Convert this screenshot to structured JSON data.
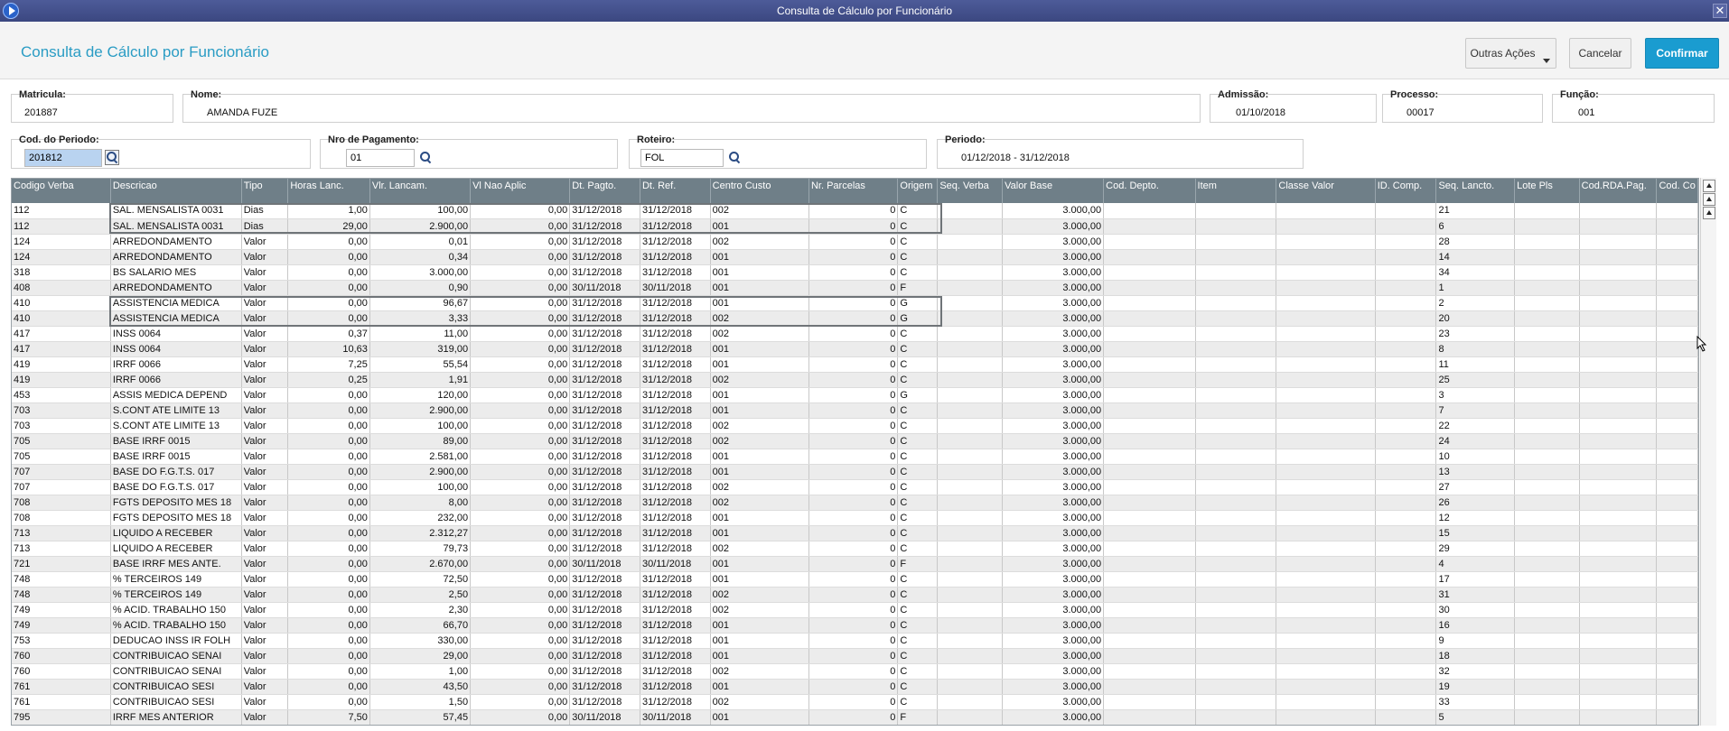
{
  "window": {
    "title": "Consulta de Cálculo por Funcionário"
  },
  "header": {
    "title": "Consulta de Cálculo por Funcionário",
    "buttons": {
      "outras_acoes": "Outras Ações",
      "cancelar": "Cancelar",
      "confirmar": "Confirmar"
    }
  },
  "form": {
    "matricula": {
      "label": "Matricula:",
      "value": "201887"
    },
    "nome": {
      "label": "Nome:",
      "value": "AMANDA FUZE"
    },
    "admissao": {
      "label": "Admissão:",
      "value": "01/10/2018"
    },
    "processo": {
      "label": "Processo:",
      "value": "00017"
    },
    "funcao": {
      "label": "Função:",
      "value": "001"
    },
    "periodo_cod": {
      "label": "Cod. do Periodo:",
      "value": "201812"
    },
    "nro_pagamento": {
      "label": "Nro de Pagamento:",
      "value": "01"
    },
    "roteiro": {
      "label": "Roteiro:",
      "value": "FOL"
    },
    "periodo": {
      "label": "Periodo:",
      "value": "01/12/2018 - 31/12/2018"
    }
  },
  "grid": {
    "columns": [
      "Codigo Verba",
      "Descricao",
      "Tipo",
      "Horas Lanc.",
      "Vlr. Lancam.",
      "Vl Nao Aplic",
      "Dt. Pagto.",
      "Dt. Ref.",
      "Centro Custo",
      "Nr. Parcelas",
      "Origem",
      "Seq. Verba",
      "Valor Base",
      "Cod. Depto.",
      "Item",
      "Classe Valor",
      "ID. Comp.",
      "Seq. Lancto.",
      "Lote Pls",
      "Cod.RDA.Pag.",
      "Cod. Co"
    ],
    "rows": [
      [
        "112",
        "SAL. MENSALISTA 0031",
        "Dias",
        "1,00",
        "100,00",
        "0,00",
        "31/12/2018",
        "31/12/2018",
        "002",
        "0",
        "C",
        "",
        "3.000,00",
        "",
        "",
        "",
        "",
        "21",
        "",
        "",
        ""
      ],
      [
        "112",
        "SAL. MENSALISTA 0031",
        "Dias",
        "29,00",
        "2.900,00",
        "0,00",
        "31/12/2018",
        "31/12/2018",
        "001",
        "0",
        "C",
        "",
        "3.000,00",
        "",
        "",
        "",
        "",
        "6",
        "",
        "",
        ""
      ],
      [
        "124",
        "ARREDONDAMENTO",
        "Valor",
        "0,00",
        "0,01",
        "0,00",
        "31/12/2018",
        "31/12/2018",
        "002",
        "0",
        "C",
        "",
        "3.000,00",
        "",
        "",
        "",
        "",
        "28",
        "",
        "",
        ""
      ],
      [
        "124",
        "ARREDONDAMENTO",
        "Valor",
        "0,00",
        "0,34",
        "0,00",
        "31/12/2018",
        "31/12/2018",
        "001",
        "0",
        "C",
        "",
        "3.000,00",
        "",
        "",
        "",
        "",
        "14",
        "",
        "",
        ""
      ],
      [
        "318",
        "BS SALARIO MES",
        "Valor",
        "0,00",
        "3.000,00",
        "0,00",
        "31/12/2018",
        "31/12/2018",
        "001",
        "0",
        "C",
        "",
        "3.000,00",
        "",
        "",
        "",
        "",
        "34",
        "",
        "",
        ""
      ],
      [
        "408",
        "ARREDONDAMENTO",
        "Valor",
        "0,00",
        "0,90",
        "0,00",
        "30/11/2018",
        "30/11/2018",
        "001",
        "0",
        "F",
        "",
        "3.000,00",
        "",
        "",
        "",
        "",
        "1",
        "",
        "",
        ""
      ],
      [
        "410",
        "ASSISTENCIA MEDICA",
        "Valor",
        "0,00",
        "96,67",
        "0,00",
        "31/12/2018",
        "31/12/2018",
        "001",
        "0",
        "G",
        "",
        "3.000,00",
        "",
        "",
        "",
        "",
        "2",
        "",
        "",
        ""
      ],
      [
        "410",
        "ASSISTENCIA MEDICA",
        "Valor",
        "0,00",
        "3,33",
        "0,00",
        "31/12/2018",
        "31/12/2018",
        "002",
        "0",
        "G",
        "",
        "3.000,00",
        "",
        "",
        "",
        "",
        "20",
        "",
        "",
        ""
      ],
      [
        "417",
        "INSS 0064",
        "Valor",
        "0,37",
        "11,00",
        "0,00",
        "31/12/2018",
        "31/12/2018",
        "002",
        "0",
        "C",
        "",
        "3.000,00",
        "",
        "",
        "",
        "",
        "23",
        "",
        "",
        ""
      ],
      [
        "417",
        "INSS 0064",
        "Valor",
        "10,63",
        "319,00",
        "0,00",
        "31/12/2018",
        "31/12/2018",
        "001",
        "0",
        "C",
        "",
        "3.000,00",
        "",
        "",
        "",
        "",
        "8",
        "",
        "",
        ""
      ],
      [
        "419",
        "IRRF 0066",
        "Valor",
        "7,25",
        "55,54",
        "0,00",
        "31/12/2018",
        "31/12/2018",
        "001",
        "0",
        "C",
        "",
        "3.000,00",
        "",
        "",
        "",
        "",
        "11",
        "",
        "",
        ""
      ],
      [
        "419",
        "IRRF 0066",
        "Valor",
        "0,25",
        "1,91",
        "0,00",
        "31/12/2018",
        "31/12/2018",
        "002",
        "0",
        "C",
        "",
        "3.000,00",
        "",
        "",
        "",
        "",
        "25",
        "",
        "",
        ""
      ],
      [
        "453",
        "ASSIS MEDICA DEPEND",
        "Valor",
        "0,00",
        "120,00",
        "0,00",
        "31/12/2018",
        "31/12/2018",
        "001",
        "0",
        "G",
        "",
        "3.000,00",
        "",
        "",
        "",
        "",
        "3",
        "",
        "",
        ""
      ],
      [
        "703",
        "S.CONT ATE LIMITE 13",
        "Valor",
        "0,00",
        "2.900,00",
        "0,00",
        "31/12/2018",
        "31/12/2018",
        "001",
        "0",
        "C",
        "",
        "3.000,00",
        "",
        "",
        "",
        "",
        "7",
        "",
        "",
        ""
      ],
      [
        "703",
        "S.CONT ATE LIMITE 13",
        "Valor",
        "0,00",
        "100,00",
        "0,00",
        "31/12/2018",
        "31/12/2018",
        "002",
        "0",
        "C",
        "",
        "3.000,00",
        "",
        "",
        "",
        "",
        "22",
        "",
        "",
        ""
      ],
      [
        "705",
        "BASE IRRF 0015",
        "Valor",
        "0,00",
        "89,00",
        "0,00",
        "31/12/2018",
        "31/12/2018",
        "002",
        "0",
        "C",
        "",
        "3.000,00",
        "",
        "",
        "",
        "",
        "24",
        "",
        "",
        ""
      ],
      [
        "705",
        "BASE IRRF 0015",
        "Valor",
        "0,00",
        "2.581,00",
        "0,00",
        "31/12/2018",
        "31/12/2018",
        "001",
        "0",
        "C",
        "",
        "3.000,00",
        "",
        "",
        "",
        "",
        "10",
        "",
        "",
        ""
      ],
      [
        "707",
        "BASE DO F.G.T.S. 017",
        "Valor",
        "0,00",
        "2.900,00",
        "0,00",
        "31/12/2018",
        "31/12/2018",
        "001",
        "0",
        "C",
        "",
        "3.000,00",
        "",
        "",
        "",
        "",
        "13",
        "",
        "",
        ""
      ],
      [
        "707",
        "BASE DO F.G.T.S. 017",
        "Valor",
        "0,00",
        "100,00",
        "0,00",
        "31/12/2018",
        "31/12/2018",
        "002",
        "0",
        "C",
        "",
        "3.000,00",
        "",
        "",
        "",
        "",
        "27",
        "",
        "",
        ""
      ],
      [
        "708",
        "FGTS DEPOSITO MES 18",
        "Valor",
        "0,00",
        "8,00",
        "0,00",
        "31/12/2018",
        "31/12/2018",
        "002",
        "0",
        "C",
        "",
        "3.000,00",
        "",
        "",
        "",
        "",
        "26",
        "",
        "",
        ""
      ],
      [
        "708",
        "FGTS DEPOSITO MES 18",
        "Valor",
        "0,00",
        "232,00",
        "0,00",
        "31/12/2018",
        "31/12/2018",
        "001",
        "0",
        "C",
        "",
        "3.000,00",
        "",
        "",
        "",
        "",
        "12",
        "",
        "",
        ""
      ],
      [
        "713",
        "LIQUIDO A RECEBER",
        "Valor",
        "0,00",
        "2.312,27",
        "0,00",
        "31/12/2018",
        "31/12/2018",
        "001",
        "0",
        "C",
        "",
        "3.000,00",
        "",
        "",
        "",
        "",
        "15",
        "",
        "",
        ""
      ],
      [
        "713",
        "LIQUIDO A RECEBER",
        "Valor",
        "0,00",
        "79,73",
        "0,00",
        "31/12/2018",
        "31/12/2018",
        "002",
        "0",
        "C",
        "",
        "3.000,00",
        "",
        "",
        "",
        "",
        "29",
        "",
        "",
        ""
      ],
      [
        "721",
        "BASE IRRF MES ANTE.",
        "Valor",
        "0,00",
        "2.670,00",
        "0,00",
        "30/11/2018",
        "30/11/2018",
        "001",
        "0",
        "F",
        "",
        "3.000,00",
        "",
        "",
        "",
        "",
        "4",
        "",
        "",
        ""
      ],
      [
        "748",
        "% TERCEIROS 149",
        "Valor",
        "0,00",
        "72,50",
        "0,00",
        "31/12/2018",
        "31/12/2018",
        "001",
        "0",
        "C",
        "",
        "3.000,00",
        "",
        "",
        "",
        "",
        "17",
        "",
        "",
        ""
      ],
      [
        "748",
        "% TERCEIROS 149",
        "Valor",
        "0,00",
        "2,50",
        "0,00",
        "31/12/2018",
        "31/12/2018",
        "002",
        "0",
        "C",
        "",
        "3.000,00",
        "",
        "",
        "",
        "",
        "31",
        "",
        "",
        ""
      ],
      [
        "749",
        "% ACID. TRABALHO 150",
        "Valor",
        "0,00",
        "2,30",
        "0,00",
        "31/12/2018",
        "31/12/2018",
        "002",
        "0",
        "C",
        "",
        "3.000,00",
        "",
        "",
        "",
        "",
        "30",
        "",
        "",
        ""
      ],
      [
        "749",
        "% ACID. TRABALHO 150",
        "Valor",
        "0,00",
        "66,70",
        "0,00",
        "31/12/2018",
        "31/12/2018",
        "001",
        "0",
        "C",
        "",
        "3.000,00",
        "",
        "",
        "",
        "",
        "16",
        "",
        "",
        ""
      ],
      [
        "753",
        "DEDUCAO INSS IR FOLH",
        "Valor",
        "0,00",
        "330,00",
        "0,00",
        "31/12/2018",
        "31/12/2018",
        "001",
        "0",
        "C",
        "",
        "3.000,00",
        "",
        "",
        "",
        "",
        "9",
        "",
        "",
        ""
      ],
      [
        "760",
        "CONTRIBUICAO SENAI",
        "Valor",
        "0,00",
        "29,00",
        "0,00",
        "31/12/2018",
        "31/12/2018",
        "001",
        "0",
        "C",
        "",
        "3.000,00",
        "",
        "",
        "",
        "",
        "18",
        "",
        "",
        ""
      ],
      [
        "760",
        "CONTRIBUICAO SENAI",
        "Valor",
        "0,00",
        "1,00",
        "0,00",
        "31/12/2018",
        "31/12/2018",
        "002",
        "0",
        "C",
        "",
        "3.000,00",
        "",
        "",
        "",
        "",
        "32",
        "",
        "",
        ""
      ],
      [
        "761",
        "CONTRIBUICAO SESI",
        "Valor",
        "0,00",
        "43,50",
        "0,00",
        "31/12/2018",
        "31/12/2018",
        "001",
        "0",
        "C",
        "",
        "3.000,00",
        "",
        "",
        "",
        "",
        "19",
        "",
        "",
        ""
      ],
      [
        "761",
        "CONTRIBUICAO SESI",
        "Valor",
        "0,00",
        "1,50",
        "0,00",
        "31/12/2018",
        "31/12/2018",
        "002",
        "0",
        "C",
        "",
        "3.000,00",
        "",
        "",
        "",
        "",
        "33",
        "",
        "",
        ""
      ],
      [
        "795",
        "IRRF MES ANTERIOR",
        "Valor",
        "7,50",
        "57,45",
        "0,00",
        "30/11/2018",
        "30/11/2018",
        "001",
        "0",
        "F",
        "",
        "3.000,00",
        "",
        "",
        "",
        "",
        "5",
        "",
        "",
        ""
      ]
    ]
  },
  "icons": {
    "search": "search-icon",
    "app": "app-icon",
    "close": "close-icon"
  }
}
